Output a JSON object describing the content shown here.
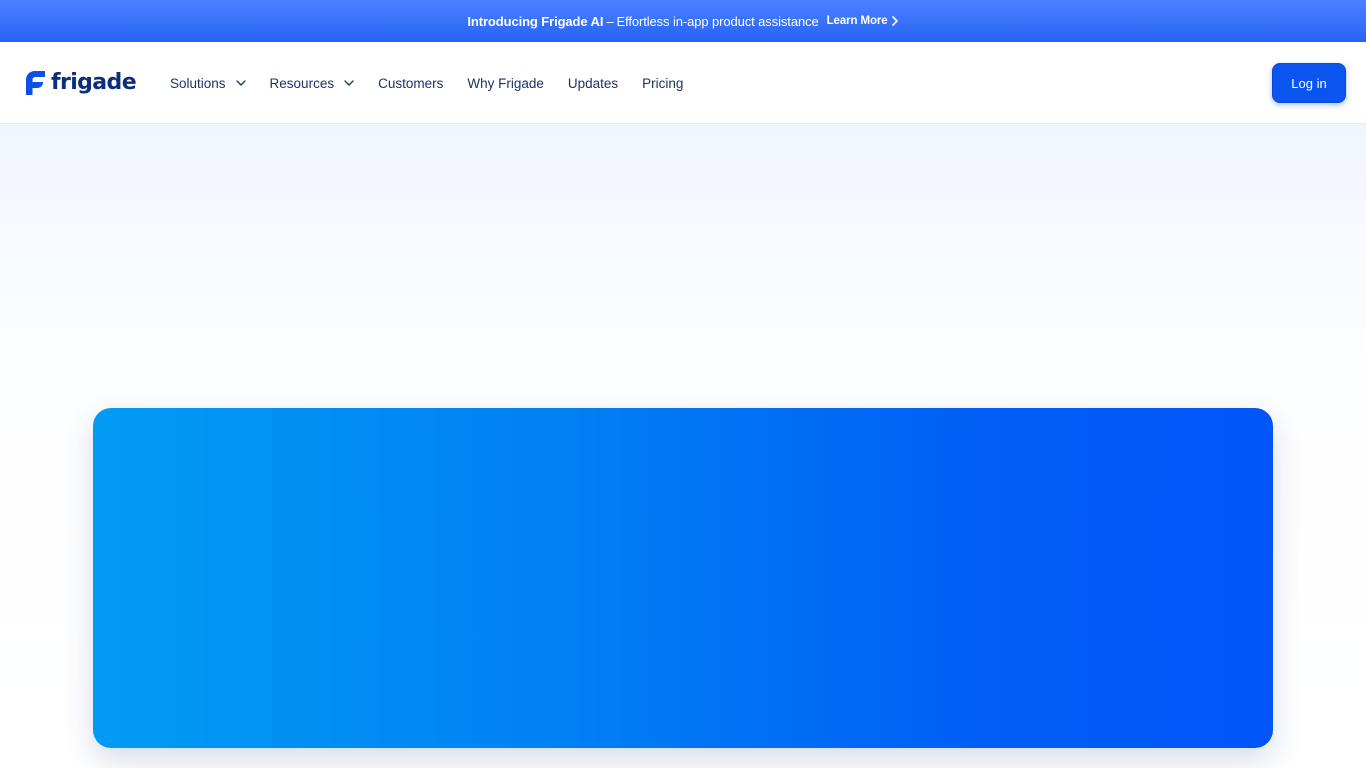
{
  "announcement": {
    "bold": "Introducing Frigade AI",
    "dash": "–",
    "text": "Effortless in-app product assistance",
    "link": "Learn More",
    "link_icon": "chevron-right-icon"
  },
  "header": {
    "logo_text": "frigade",
    "nav": {
      "solutions": "Solutions",
      "resources": "Resources",
      "customers": "Customers",
      "why": "Why Frigade",
      "updates": "Updates",
      "pricing": "Pricing"
    },
    "dropdown_icon": "chevron-down-icon",
    "login": "Log in"
  },
  "colors": {
    "brand": "#0a55f0",
    "nav_text": "#1d3461",
    "logo_text": "#0b2f7a",
    "banner": "#2f6cf7",
    "card_gradient_start": "#029bf4",
    "card_gradient_end": "#0155f7"
  }
}
